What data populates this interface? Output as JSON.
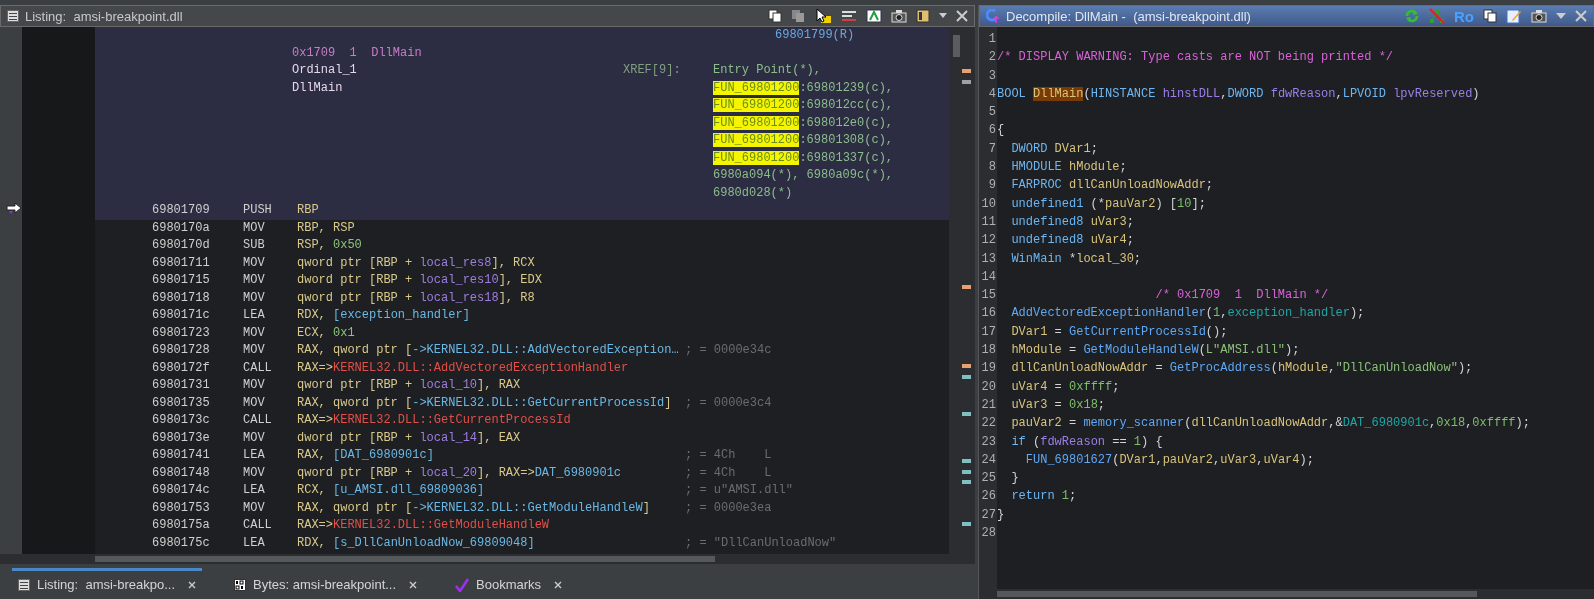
{
  "listing": {
    "title": "Listing:  amsi-breakpoint.dll",
    "xref_continued": "69801799(R)",
    "labels": [
      {
        "kind": "comment",
        "text": "0x1709  1  DllMain"
      },
      {
        "kind": "label",
        "text": "Ordinal_1"
      },
      {
        "kind": "label",
        "text": "DllMain"
      }
    ],
    "xref_label": "XREF[9]:",
    "xrefs": [
      [
        {
          "kind": "plain",
          "text": "Entry Point(*),"
        }
      ],
      [
        {
          "kind": "highlight",
          "text": "FUN_69801200"
        },
        {
          "kind": "plain",
          "text": ":69801239(c),"
        }
      ],
      [
        {
          "kind": "highlight",
          "text": "FUN_69801200"
        },
        {
          "kind": "plain",
          "text": ":698012cc(c),"
        }
      ],
      [
        {
          "kind": "highlight",
          "text": "FUN_69801200"
        },
        {
          "kind": "plain",
          "text": ":698012e0(c),"
        }
      ],
      [
        {
          "kind": "highlight",
          "text": "FUN_69801200"
        },
        {
          "kind": "plain",
          "text": ":69801308(c),"
        }
      ],
      [
        {
          "kind": "highlight",
          "text": "FUN_69801200"
        },
        {
          "kind": "plain",
          "text": ":69801337(c),"
        }
      ],
      [
        {
          "kind": "plain",
          "text": "6980a094(*), 6980a09c(*),"
        }
      ],
      [
        {
          "kind": "plain",
          "text": "6980d028(*)"
        }
      ]
    ],
    "rows": [
      {
        "address": "69801709",
        "mnemonic": "PUSH",
        "selected": true,
        "operands": [
          {
            "kind": "reg",
            "text": "RBP"
          }
        ]
      },
      {
        "address": "6980170a",
        "mnemonic": "MOV",
        "selected": false,
        "operands": [
          {
            "kind": "reg",
            "text": "RBP, RSP"
          }
        ]
      },
      {
        "address": "6980170d",
        "mnemonic": "SUB",
        "selected": false,
        "operands": [
          {
            "kind": "reg",
            "text": "RSP, "
          },
          {
            "kind": "num",
            "text": "0x50"
          }
        ]
      },
      {
        "address": "69801711",
        "mnemonic": "MOV",
        "selected": false,
        "operands": [
          {
            "kind": "reg",
            "text": "qword ptr [RBP + "
          },
          {
            "kind": "local",
            "text": "local_res8"
          },
          {
            "kind": "reg",
            "text": "], RCX"
          }
        ]
      },
      {
        "address": "69801715",
        "mnemonic": "MOV",
        "selected": false,
        "operands": [
          {
            "kind": "reg",
            "text": "dword ptr [RBP + "
          },
          {
            "kind": "local",
            "text": "local_res10"
          },
          {
            "kind": "reg",
            "text": "], EDX"
          }
        ]
      },
      {
        "address": "69801718",
        "mnemonic": "MOV",
        "selected": false,
        "operands": [
          {
            "kind": "reg",
            "text": "qword ptr [RBP + "
          },
          {
            "kind": "local",
            "text": "local_res18"
          },
          {
            "kind": "reg",
            "text": "], R8"
          }
        ]
      },
      {
        "address": "6980171c",
        "mnemonic": "LEA",
        "selected": false,
        "operands": [
          {
            "kind": "reg",
            "text": "RDX, "
          },
          {
            "kind": "ref",
            "text": "[exception_handler]"
          }
        ]
      },
      {
        "address": "69801723",
        "mnemonic": "MOV",
        "selected": false,
        "operands": [
          {
            "kind": "reg",
            "text": "ECX, "
          },
          {
            "kind": "num",
            "text": "0x1"
          }
        ]
      },
      {
        "address": "69801728",
        "mnemonic": "MOV",
        "selected": false,
        "operands": [
          {
            "kind": "reg",
            "text": "RAX, qword ptr ["
          },
          {
            "kind": "ref",
            "text": "->KERNEL32.DLL::AddVectoredException…"
          }
        ],
        "comment": "; = 0000e34c"
      },
      {
        "address": "6980172f",
        "mnemonic": "CALL",
        "selected": false,
        "operands": [
          {
            "kind": "reg",
            "text": "RAX=>"
          },
          {
            "kind": "ext",
            "text": "KERNEL32.DLL::AddVectoredExceptionHandler"
          }
        ]
      },
      {
        "address": "69801731",
        "mnemonic": "MOV",
        "selected": false,
        "operands": [
          {
            "kind": "reg",
            "text": "qword ptr [RBP + "
          },
          {
            "kind": "local",
            "text": "local_10"
          },
          {
            "kind": "reg",
            "text": "], RAX"
          }
        ]
      },
      {
        "address": "69801735",
        "mnemonic": "MOV",
        "selected": false,
        "operands": [
          {
            "kind": "reg",
            "text": "RAX, qword ptr ["
          },
          {
            "kind": "ref",
            "text": "->KERNEL32.DLL::GetCurrentProcessId"
          },
          {
            "kind": "reg",
            "text": "]"
          }
        ],
        "comment": "; = 0000e3c4"
      },
      {
        "address": "6980173c",
        "mnemonic": "CALL",
        "selected": false,
        "operands": [
          {
            "kind": "reg",
            "text": "RAX=>"
          },
          {
            "kind": "ext",
            "text": "KERNEL32.DLL::GetCurrentProcessId"
          }
        ]
      },
      {
        "address": "6980173e",
        "mnemonic": "MOV",
        "selected": false,
        "operands": [
          {
            "kind": "reg",
            "text": "dword ptr [RBP + "
          },
          {
            "kind": "local",
            "text": "local_14"
          },
          {
            "kind": "reg",
            "text": "], EAX"
          }
        ]
      },
      {
        "address": "69801741",
        "mnemonic": "LEA",
        "selected": false,
        "operands": [
          {
            "kind": "reg",
            "text": "RAX, "
          },
          {
            "kind": "ref",
            "text": "[DAT_6980901c]"
          }
        ],
        "comment": "; = 4Ch    L"
      },
      {
        "address": "69801748",
        "mnemonic": "MOV",
        "selected": false,
        "operands": [
          {
            "kind": "reg",
            "text": "qword ptr [RBP + "
          },
          {
            "kind": "local",
            "text": "local_20"
          },
          {
            "kind": "reg",
            "text": "], RAX=>"
          },
          {
            "kind": "ref",
            "text": "DAT_6980901c"
          }
        ],
        "comment": "; = 4Ch    L"
      },
      {
        "address": "6980174c",
        "mnemonic": "LEA",
        "selected": false,
        "operands": [
          {
            "kind": "reg",
            "text": "RCX, "
          },
          {
            "kind": "ref",
            "text": "[u_AMSI.dll_69809036]"
          }
        ],
        "comment": "; = u\"AMSI.dll\""
      },
      {
        "address": "69801753",
        "mnemonic": "MOV",
        "selected": false,
        "operands": [
          {
            "kind": "reg",
            "text": "RAX, qword ptr ["
          },
          {
            "kind": "ref",
            "text": "->KERNEL32.DLL::GetModuleHandleW"
          },
          {
            "kind": "reg",
            "text": "]"
          }
        ],
        "comment": "; = 0000e3ea"
      },
      {
        "address": "6980175a",
        "mnemonic": "CALL",
        "selected": false,
        "operands": [
          {
            "kind": "reg",
            "text": "RAX=>"
          },
          {
            "kind": "ext",
            "text": "KERNEL32.DLL::GetModuleHandleW"
          }
        ]
      },
      {
        "address": "6980175c",
        "mnemonic": "LEA",
        "selected": false,
        "operands": [
          {
            "kind": "reg",
            "text": "RDX, "
          },
          {
            "kind": "ref",
            "text": "[s_DllCanUnloadNow_69809048]"
          }
        ],
        "comment": "; = \"DllCanUnloadNow\""
      }
    ]
  },
  "tabs": [
    {
      "label": "Listing:  amsi-breakpo...",
      "kind": "listing",
      "selected": true
    },
    {
      "label": "Bytes: amsi-breakpoint...",
      "kind": "bytes",
      "selected": false
    },
    {
      "label": "Bookmarks",
      "kind": "bookmarks",
      "selected": false
    }
  ],
  "decompile": {
    "title": "Decompile: DllMain -  (amsi-breakpoint.dll)",
    "toolbar_label": "Ro",
    "lines": [
      {
        "number": "1"
      },
      {
        "number": "2",
        "tokens": [
          {
            "kind": "comment",
            "text": "/* DISPLAY WARNING: Type casts are NOT being printed */"
          }
        ]
      },
      {
        "number": "3"
      },
      {
        "number": "4",
        "tokens": [
          {
            "kind": "type",
            "text": "BOOL "
          },
          {
            "kind": "current",
            "text": "DllMain"
          },
          {
            "kind": "plain",
            "text": "("
          },
          {
            "kind": "type",
            "text": "HINSTANCE "
          },
          {
            "kind": "param",
            "text": "hinstDLL"
          },
          {
            "kind": "plain",
            "text": ","
          },
          {
            "kind": "type",
            "text": "DWORD "
          },
          {
            "kind": "param",
            "text": "fdwReason"
          },
          {
            "kind": "plain",
            "text": ","
          },
          {
            "kind": "type",
            "text": "LPVOID "
          },
          {
            "kind": "param",
            "text": "lpvReserved"
          },
          {
            "kind": "plain",
            "text": ")"
          }
        ]
      },
      {
        "number": "5"
      },
      {
        "number": "6",
        "tokens": [
          {
            "kind": "plain",
            "text": "{"
          }
        ]
      },
      {
        "number": "7",
        "tokens": [
          {
            "kind": "type",
            "text": "  DWORD "
          },
          {
            "kind": "var",
            "text": "DVar1"
          },
          {
            "kind": "plain",
            "text": ";"
          }
        ]
      },
      {
        "number": "8",
        "tokens": [
          {
            "kind": "type",
            "text": "  HMODULE "
          },
          {
            "kind": "var",
            "text": "hModule"
          },
          {
            "kind": "plain",
            "text": ";"
          }
        ]
      },
      {
        "number": "9",
        "tokens": [
          {
            "kind": "type",
            "text": "  FARPROC "
          },
          {
            "kind": "var",
            "text": "dllCanUnloadNowAddr"
          },
          {
            "kind": "plain",
            "text": ";"
          }
        ]
      },
      {
        "number": "10",
        "tokens": [
          {
            "kind": "type",
            "text": "  undefined1"
          },
          {
            "kind": "plain",
            "text": " (*"
          },
          {
            "kind": "var",
            "text": "pauVar2"
          },
          {
            "kind": "plain",
            "text": ") ["
          },
          {
            "kind": "num",
            "text": "10"
          },
          {
            "kind": "plain",
            "text": "];"
          }
        ]
      },
      {
        "number": "11",
        "tokens": [
          {
            "kind": "type",
            "text": "  undefined8 "
          },
          {
            "kind": "var",
            "text": "uVar3"
          },
          {
            "kind": "plain",
            "text": ";"
          }
        ]
      },
      {
        "number": "12",
        "tokens": [
          {
            "kind": "type",
            "text": "  undefined8 "
          },
          {
            "kind": "var",
            "text": "uVar4"
          },
          {
            "kind": "plain",
            "text": ";"
          }
        ]
      },
      {
        "number": "13",
        "tokens": [
          {
            "kind": "type",
            "text": "  WinMain"
          },
          {
            "kind": "plain",
            "text": " *"
          },
          {
            "kind": "var",
            "text": "local_30"
          },
          {
            "kind": "plain",
            "text": ";"
          }
        ]
      },
      {
        "number": "14"
      },
      {
        "number": "15",
        "tokens": [
          {
            "kind": "comment",
            "text": "                      /* 0x1709  1  DllMain */"
          }
        ]
      },
      {
        "number": "16",
        "tokens": [
          {
            "kind": "func",
            "text": "  AddVectoredExceptionHandler"
          },
          {
            "kind": "plain",
            "text": "("
          },
          {
            "kind": "num",
            "text": "1"
          },
          {
            "kind": "plain",
            "text": ","
          },
          {
            "kind": "global",
            "text": "exception_handler"
          },
          {
            "kind": "plain",
            "text": ");"
          }
        ]
      },
      {
        "number": "17",
        "tokens": [
          {
            "kind": "var",
            "text": "  DVar1"
          },
          {
            "kind": "plain",
            "text": " = "
          },
          {
            "kind": "func",
            "text": "GetCurrentProcessId"
          },
          {
            "kind": "plain",
            "text": "();"
          }
        ]
      },
      {
        "number": "18",
        "tokens": [
          {
            "kind": "var",
            "text": "  hModule"
          },
          {
            "kind": "plain",
            "text": " = "
          },
          {
            "kind": "func",
            "text": "GetModuleHandleW"
          },
          {
            "kind": "plain",
            "text": "("
          },
          {
            "kind": "str",
            "text": "L\"AMSI.dll\""
          },
          {
            "kind": "plain",
            "text": ");"
          }
        ]
      },
      {
        "number": "19",
        "tokens": [
          {
            "kind": "var",
            "text": "  dllCanUnloadNowAddr"
          },
          {
            "kind": "plain",
            "text": " = "
          },
          {
            "kind": "func",
            "text": "GetProcAddress"
          },
          {
            "kind": "plain",
            "text": "("
          },
          {
            "kind": "var",
            "text": "hModule"
          },
          {
            "kind": "plain",
            "text": ","
          },
          {
            "kind": "str",
            "text": "\"DllCanUnloadNow\""
          },
          {
            "kind": "plain",
            "text": ");"
          }
        ]
      },
      {
        "number": "20",
        "tokens": [
          {
            "kind": "var",
            "text": "  uVar4"
          },
          {
            "kind": "plain",
            "text": " = "
          },
          {
            "kind": "num",
            "text": "0xffff"
          },
          {
            "kind": "plain",
            "text": ";"
          }
        ]
      },
      {
        "number": "21",
        "tokens": [
          {
            "kind": "var",
            "text": "  uVar3"
          },
          {
            "kind": "plain",
            "text": " = "
          },
          {
            "kind": "num",
            "text": "0x18"
          },
          {
            "kind": "plain",
            "text": ";"
          }
        ]
      },
      {
        "number": "22",
        "tokens": [
          {
            "kind": "var",
            "text": "  pauVar2"
          },
          {
            "kind": "plain",
            "text": " = "
          },
          {
            "kind": "func",
            "text": "memory_scanner"
          },
          {
            "kind": "plain",
            "text": "("
          },
          {
            "kind": "var",
            "text": "dllCanUnloadNowAddr"
          },
          {
            "kind": "plain",
            "text": ",&"
          },
          {
            "kind": "global",
            "text": "DAT_6980901c"
          },
          {
            "kind": "plain",
            "text": ","
          },
          {
            "kind": "num",
            "text": "0x18"
          },
          {
            "kind": "plain",
            "text": ","
          },
          {
            "kind": "num",
            "text": "0xffff"
          },
          {
            "kind": "plain",
            "text": ");"
          }
        ]
      },
      {
        "number": "23",
        "tokens": [
          {
            "kind": "type",
            "text": "  if"
          },
          {
            "kind": "plain",
            "text": " ("
          },
          {
            "kind": "param",
            "text": "fdwReason"
          },
          {
            "kind": "plain",
            "text": " == "
          },
          {
            "kind": "num",
            "text": "1"
          },
          {
            "kind": "plain",
            "text": ") {"
          }
        ]
      },
      {
        "number": "24",
        "tokens": [
          {
            "kind": "func",
            "text": "    FUN_69801627"
          },
          {
            "kind": "plain",
            "text": "("
          },
          {
            "kind": "var",
            "text": "DVar1"
          },
          {
            "kind": "plain",
            "text": ","
          },
          {
            "kind": "var",
            "text": "pauVar2"
          },
          {
            "kind": "plain",
            "text": ","
          },
          {
            "kind": "var",
            "text": "uVar3"
          },
          {
            "kind": "plain",
            "text": ","
          },
          {
            "kind": "var",
            "text": "uVar4"
          },
          {
            "kind": "plain",
            "text": ");"
          }
        ]
      },
      {
        "number": "25",
        "tokens": [
          {
            "kind": "plain",
            "text": "  }"
          }
        ]
      },
      {
        "number": "26",
        "tokens": [
          {
            "kind": "type",
            "text": "  return "
          },
          {
            "kind": "num",
            "text": "1"
          },
          {
            "kind": "plain",
            "text": ";"
          }
        ]
      },
      {
        "number": "27",
        "tokens": [
          {
            "kind": "plain",
            "text": "}"
          }
        ]
      },
      {
        "number": "28"
      }
    ]
  }
}
